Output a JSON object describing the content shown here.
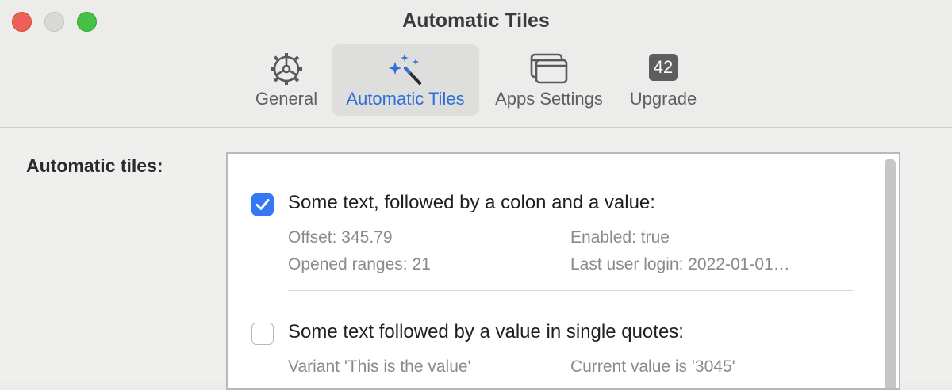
{
  "window": {
    "title": "Automatic Tiles"
  },
  "toolbar": {
    "tabs": [
      {
        "label": "General",
        "icon": "gear-icon"
      },
      {
        "label": "Automatic Tiles",
        "icon": "magic-wand-icon",
        "active": true
      },
      {
        "label": "Apps Settings",
        "icon": "windows-icon"
      },
      {
        "label": "Upgrade",
        "icon": "badge-icon",
        "badge": "42"
      }
    ]
  },
  "content": {
    "section_label": "Automatic tiles:",
    "items": [
      {
        "checked": true,
        "title": "Some text, followed by a colon and a value:",
        "details": [
          "Offset: 345.79",
          "Enabled: true",
          "Opened ranges: 21",
          "Last user login: 2022-01-01…"
        ]
      },
      {
        "checked": false,
        "title": "Some text followed by a value in single quotes:",
        "details": [
          "Variant 'This is the value'",
          "Current value is '3045'"
        ]
      }
    ]
  },
  "colors": {
    "accent": "#3478f6",
    "active_tab_text": "#2e6fd8"
  }
}
